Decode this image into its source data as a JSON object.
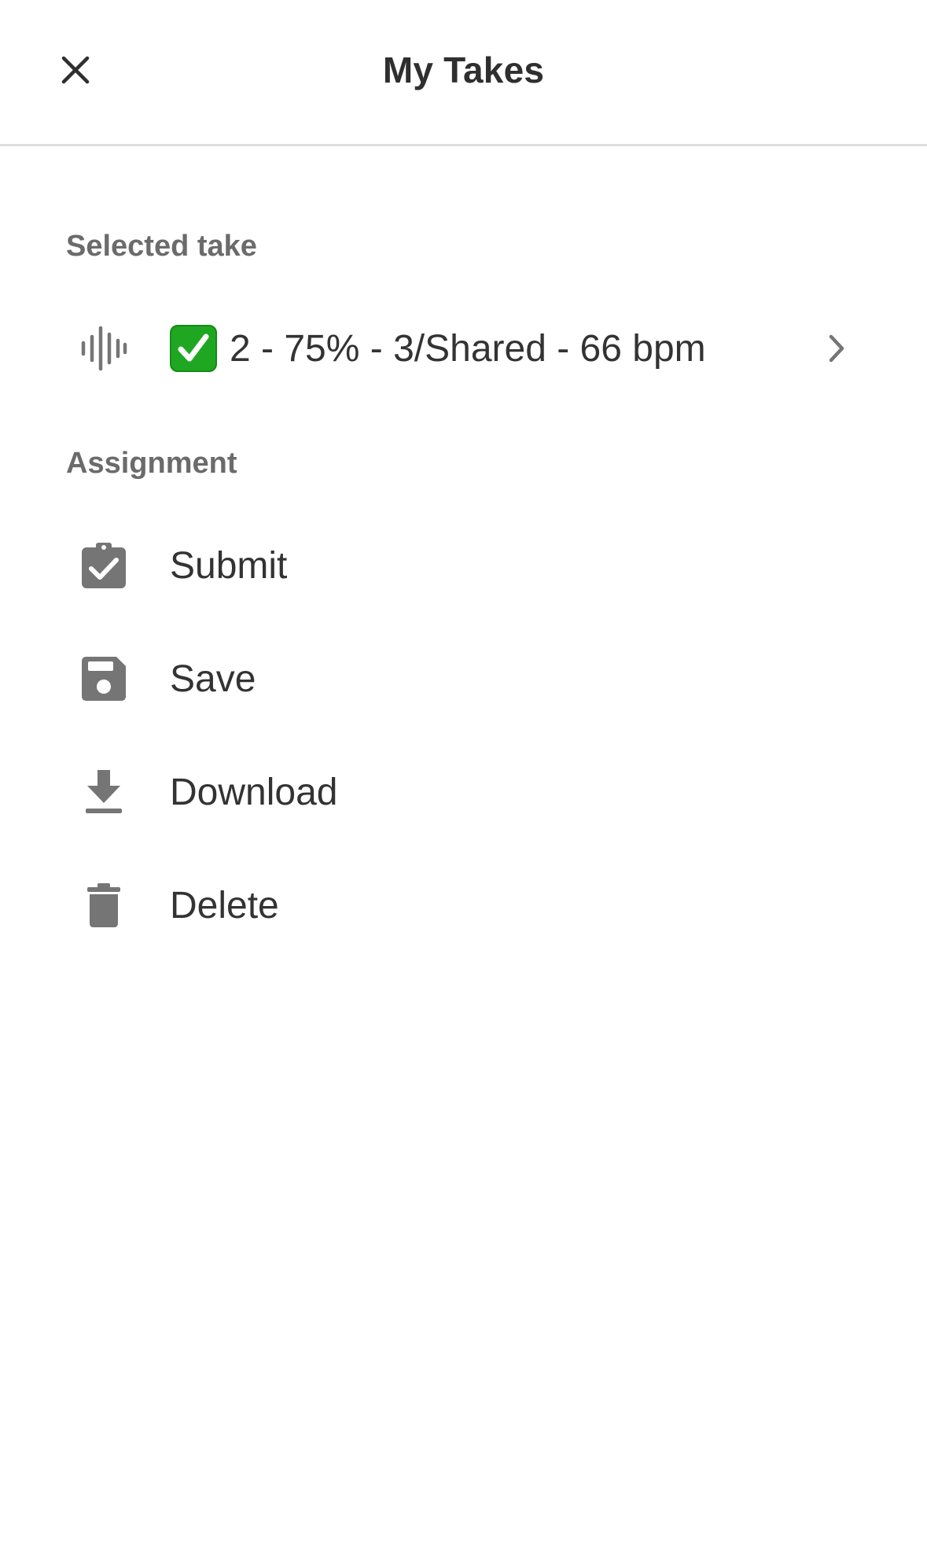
{
  "header": {
    "title": "My Takes",
    "close_icon": "close-icon"
  },
  "selected_take": {
    "section_label": "Selected take",
    "icon": "waveform-icon",
    "status_icon": "check-mark-button-emoji",
    "label": "2 - 75% - 3/Shared - 66 bpm",
    "chevron_icon": "chevron-right-icon"
  },
  "assignment": {
    "section_label": "Assignment",
    "actions": [
      {
        "label": "Submit",
        "icon": "clipboard-check-icon"
      },
      {
        "label": "Save",
        "icon": "save-icon"
      },
      {
        "label": "Download",
        "icon": "download-icon"
      },
      {
        "label": "Delete",
        "icon": "trash-icon"
      }
    ]
  },
  "colors": {
    "icon_gray": "#757575",
    "text": "#333333",
    "section_label": "#6b6b6b",
    "divider": "#dedede",
    "check_green": "#1fa722"
  }
}
